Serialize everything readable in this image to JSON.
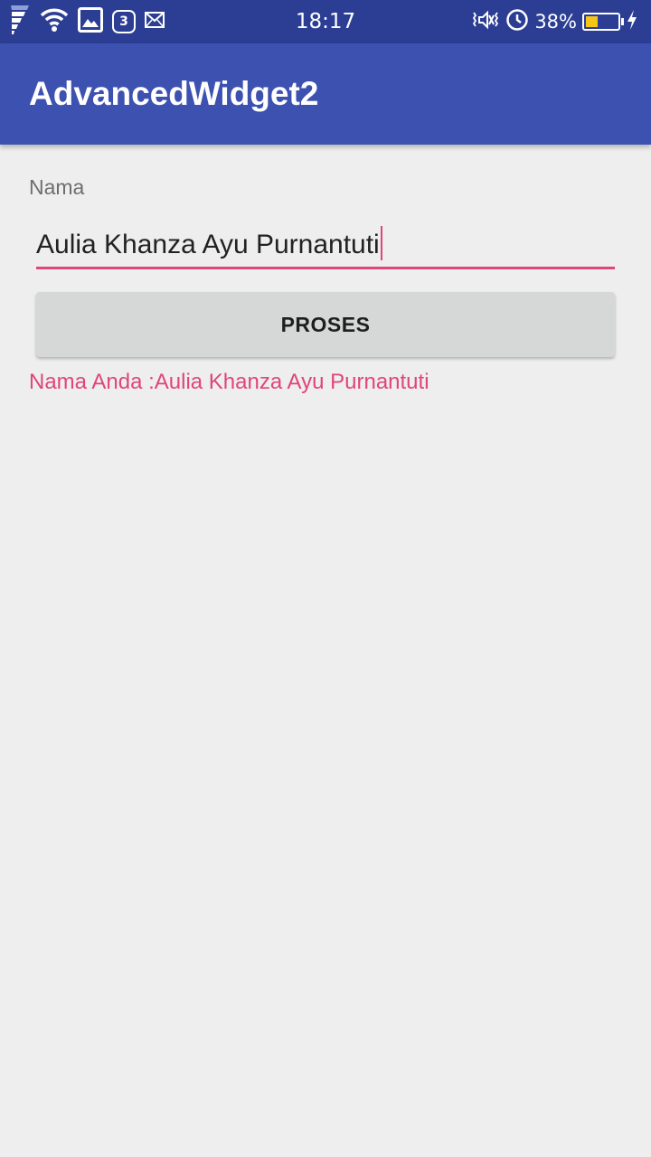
{
  "status_bar": {
    "time": "18:17",
    "notification_count": "3",
    "battery_percent": "38%",
    "battery_level": 0.38,
    "icons": [
      "signal-icon",
      "wifi-icon",
      "image-icon",
      "mail-icon",
      "vibrate-icon",
      "alarm-icon",
      "battery-icon",
      "charging-icon"
    ]
  },
  "app_bar": {
    "title": "AdvancedWidget2",
    "color": "#3d51b0"
  },
  "form": {
    "label": "Nama",
    "input_value": "Aulia Khanza Ayu Purnantuti",
    "button_label": "PROSES",
    "result": "Nama Anda :Aulia Khanza Ayu Purnantuti",
    "accent_color": "#e0457b"
  }
}
